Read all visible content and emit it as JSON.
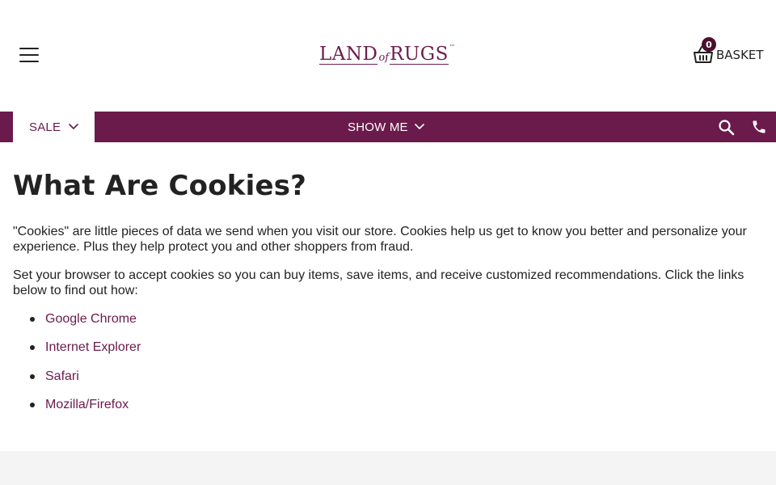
{
  "header": {
    "logo": {
      "word1": "LAND",
      "word2": "of",
      "word3": "RUGS",
      "mark": "™"
    },
    "menu_icon": "hamburger-icon",
    "basket": {
      "count": "0",
      "label": "BASKET",
      "icon": "basket-icon"
    }
  },
  "nav": {
    "sale_label": "SALE",
    "show_me_label": "SHOW ME",
    "search_icon": "search-icon",
    "phone_icon": "phone-icon"
  },
  "main": {
    "title": "What Are Cookies?",
    "paragraphs": [
      "\"Cookies\" are little pieces of data we send when you visit our store. Cookies help us get to know you better and personalize your experience. Plus they help protect you and other shoppers from fraud.",
      "Set your browser to accept cookies so you can buy items, save items, and receive customized recommendations. Click the links below to find out how:"
    ],
    "links": [
      "Google Chrome",
      "Internet Explorer",
      "Safari",
      "Mozilla/Firefox"
    ]
  },
  "colors": {
    "brand": "#6b1a4c",
    "badge": "#4a1030",
    "footer_band": "#f5f4f4",
    "text": "#222222"
  }
}
